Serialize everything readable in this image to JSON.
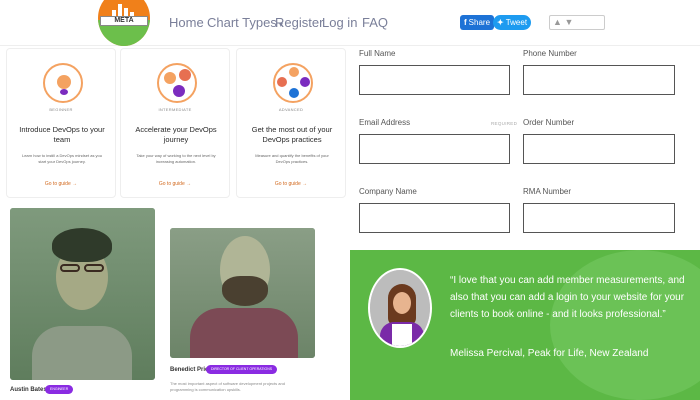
{
  "nav": {
    "logo_text": "META",
    "links": [
      "Home",
      "Chart Types",
      "Register",
      "Log in",
      "FAQ"
    ],
    "share_label": "Share",
    "tweet_label": "Tweet"
  },
  "cards": [
    {
      "tag": "Beginner",
      "title": "Introduce DevOps to your team",
      "desc": "Learn how to instill a DevOps mindset as you start your DevOps journey.",
      "link": "Go to guide →"
    },
    {
      "tag": "Intermediate",
      "title": "Accelerate your DevOps journey",
      "desc": "Take your way of working to the next level by increasing automation.",
      "link": "Go to guide →"
    },
    {
      "tag": "Advanced",
      "title": "Get the most out of your DevOps practices",
      "desc": "Measure and quantify the benefits of your DevOps practices.",
      "link": "Go to guide →"
    }
  ],
  "people": [
    {
      "name": "Austin Bates",
      "badge": "Engineer"
    },
    {
      "name": "Benedict Price",
      "badge": "Director of Client Operations",
      "desc": "The most important aspect of software development projects and programming is communication upskills."
    }
  ],
  "form": {
    "full_name": {
      "label": "Full Name",
      "value": ""
    },
    "phone": {
      "label": "Phone Number",
      "value": ""
    },
    "email": {
      "label": "Email Address",
      "required": "REQUIRED",
      "value": ""
    },
    "order": {
      "label": "Order Number",
      "value": ""
    },
    "company": {
      "label": "Company Name",
      "value": ""
    },
    "rma": {
      "label": "RMA Number",
      "value": ""
    }
  },
  "testimonial": {
    "quote": "“I love that you can add member measurements, and also that you can add a login to your website for your clients to book online - and it looks professional.”",
    "author": "Melissa Percival, Peak for Life, New Zealand"
  },
  "colors": {
    "brand_orange": "#f0801a",
    "brand_green": "#6cbf4b",
    "share_blue": "#1d72d6",
    "tweet_blue": "#1d9bf0",
    "badge_purple": "#8a2be2",
    "testimonial_green": "#5cb845"
  }
}
